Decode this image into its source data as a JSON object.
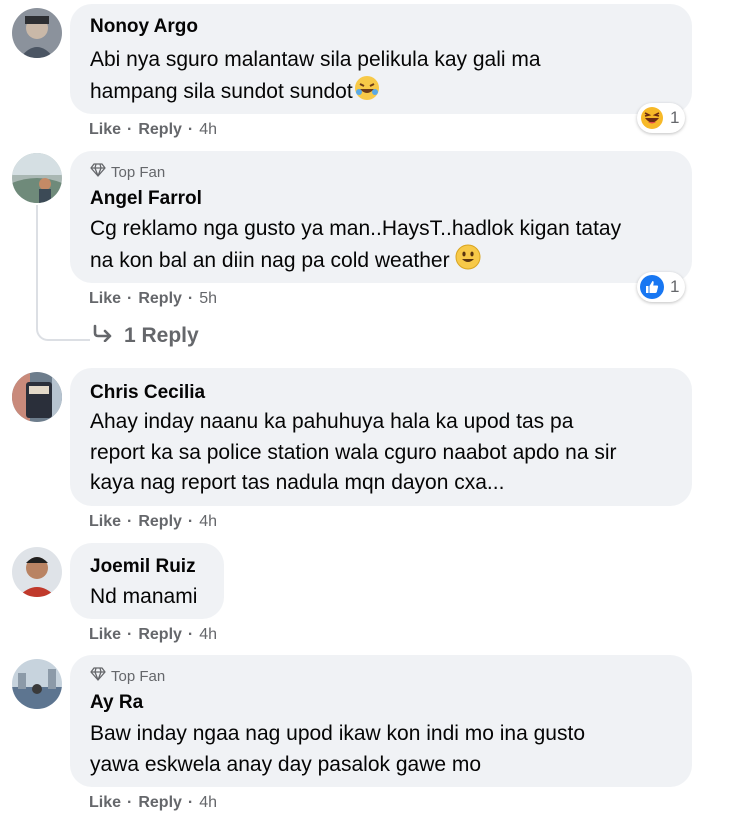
{
  "colors": {
    "bubble": "#f0f2f5",
    "meta": "#65676b",
    "like_blue": "#1877f2"
  },
  "actions": {
    "like": "Like",
    "reply": "Reply",
    "sep": "·"
  },
  "comments": [
    {
      "author": "Nonoy Argo",
      "badge": "",
      "lines": [
        "Abi nya sguro malantaw sila pelikula kay gali ma",
        "hampang sila sundot sundot"
      ],
      "trailing_emoji": "rolling-laughing-icon",
      "time": "4h",
      "reaction": {
        "icon": "haha-reaction-icon",
        "count": "1"
      }
    },
    {
      "author": "Angel Farrol",
      "badge": "Top Fan",
      "lines": [
        "Cg reklamo nga gusto ya man..HaysT..hadlok kigan tatay",
        "na kon bal an diin nag pa cold weather"
      ],
      "trailing_emoji": "smile-icon",
      "time": "5h",
      "reaction": {
        "icon": "like-reaction-icon",
        "count": "1"
      },
      "replies_label": "1 Reply"
    },
    {
      "author": "Chris Cecilia",
      "badge": "",
      "lines": [
        "Ahay inday naanu ka pahuhuya hala ka upod tas pa",
        "report ka sa police station wala cguro naabot apdo na sir",
        "kaya nag report tas nadula mqn dayon cxa..."
      ],
      "time": "4h"
    },
    {
      "author": "Joemil Ruiz",
      "badge": "",
      "lines": [
        "Nd manami"
      ],
      "time": "4h"
    },
    {
      "author": "Ay Ra",
      "badge": "Top Fan",
      "lines": [
        "Baw inday ngaa nag upod ikaw kon indi mo ina gusto",
        "yawa eskwela anay day pasalok gawe mo"
      ],
      "time": "4h"
    }
  ]
}
